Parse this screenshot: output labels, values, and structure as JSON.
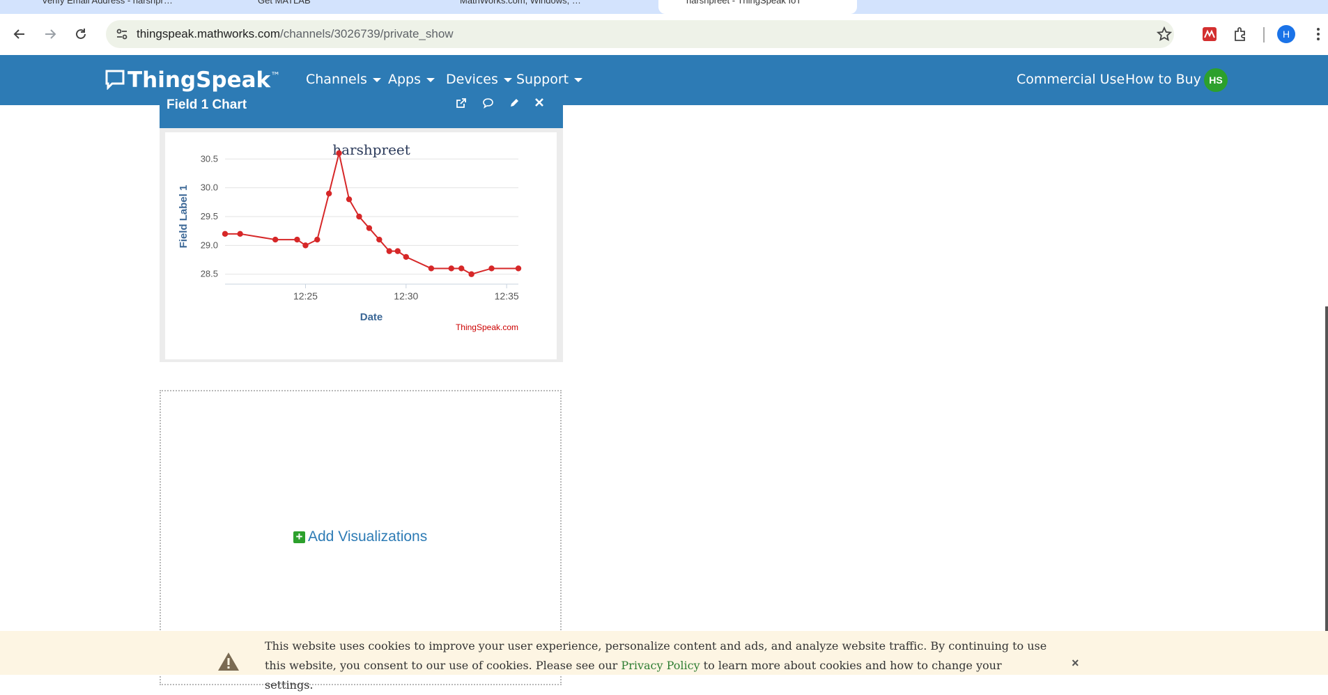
{
  "browser": {
    "tabs": [
      {
        "label": "Verify Email Address - harshpr…"
      },
      {
        "label": "Get MATLAB"
      },
      {
        "label": "MathWorks.com, Windows, …"
      },
      {
        "label": "harshpreet - ThingSpeak IoT"
      }
    ],
    "url_domain": "thingspeak.mathworks.com",
    "url_path": "/channels/3026739/private_show",
    "profile_initial": "H",
    "icons": [
      "back-icon",
      "forward-icon",
      "reload-icon",
      "site-info-icon",
      "bookmark-star-icon",
      "mathworks-extension-icon",
      "extensions-puzzle-icon",
      "menu-dots-icon"
    ]
  },
  "nav": {
    "logo": "ThingSpeak",
    "logo_tm": "™",
    "menus": [
      "Channels",
      "Apps",
      "Devices",
      "Support"
    ],
    "right_links": [
      "Commercial Use",
      "How to Buy"
    ],
    "avatar": "HS"
  },
  "panel": {
    "title": "Field 1 Chart",
    "tools": [
      "external-link-icon",
      "comment-icon",
      "pencil-icon",
      "close-icon"
    ]
  },
  "chart_data": {
    "type": "line",
    "title": "harshpreet",
    "xlabel": "Date",
    "ylabel": "Field Label 1",
    "credit": "ThingSpeak.com",
    "x_ticks": [
      "12:25",
      "12:30",
      "12:35"
    ],
    "y_ticks": [
      "30.5",
      "30.0",
      "29.5",
      "29.0",
      "28.5"
    ],
    "ylim": [
      28.4,
      30.6
    ],
    "x": [
      "12:21:00",
      "12:21:45",
      "12:23:30",
      "12:24:35",
      "12:25:00",
      "12:25:35",
      "12:26:10",
      "12:26:40",
      "12:27:10",
      "12:27:40",
      "12:28:10",
      "12:28:40",
      "12:29:10",
      "12:29:35",
      "12:30:00",
      "12:31:15",
      "12:32:15",
      "12:32:45",
      "12:33:15",
      "12:34:15",
      "12:35:35"
    ],
    "series": [
      {
        "values": [
          29.2,
          29.2,
          29.1,
          29.1,
          29.0,
          29.1,
          29.9,
          30.6,
          29.8,
          29.5,
          29.3,
          29.1,
          28.9,
          28.9,
          28.8,
          28.6,
          28.6,
          28.6,
          28.5,
          28.6,
          28.6
        ],
        "color": "#d62728"
      }
    ],
    "grid": true
  },
  "add_visualizations": "Add Visualizations",
  "cookie": {
    "text_before": "This website uses cookies to improve your user experience, personalize content and ads, and analyze website traffic. By continuing to use this website, you consent to our use of cookies. Please see our ",
    "link": "Privacy Policy",
    "text_after": " to learn more about cookies and how to change your settings.",
    "close": "×"
  }
}
